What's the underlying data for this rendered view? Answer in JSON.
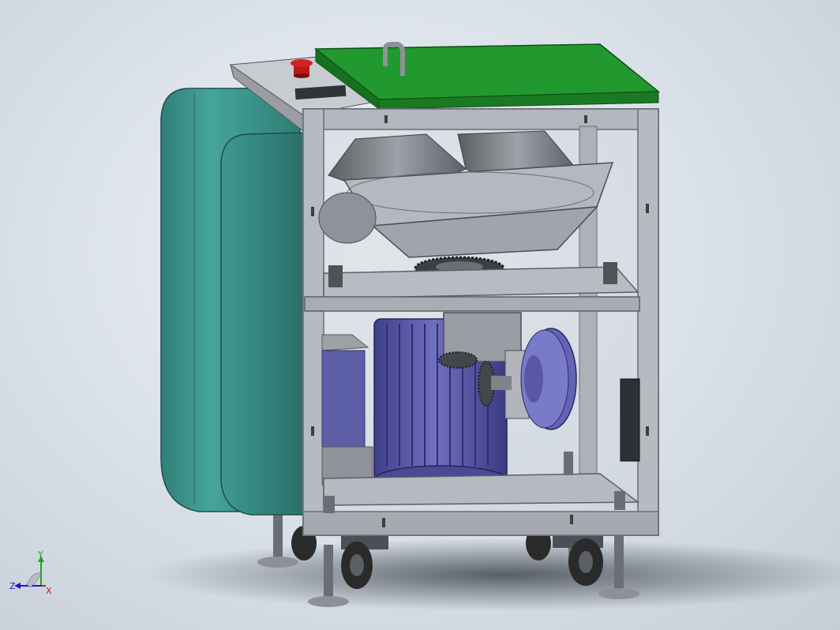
{
  "viewport": {
    "background_top": "#eef1f6",
    "background_bottom": "#c7ced8"
  },
  "model": {
    "parts": [
      "side-cover",
      "control-panel",
      "emergency-stop-button",
      "top-cover",
      "cover-handle",
      "frame",
      "hopper-tubes",
      "rotary-table",
      "gear-wheel",
      "middle-shelf",
      "drive-motor",
      "gearbox",
      "bevel-gear",
      "brake-disk",
      "side-plate",
      "base-plate",
      "caster-wheels",
      "leveling-feet"
    ],
    "colors": {
      "side_cover": "#3f9a91",
      "top_cover": "#1f8f2b",
      "frame": "#a9adb3",
      "motor": "#5a5aa8",
      "emergency_stop": "#c41818",
      "wheels": "#2a2a2a"
    }
  },
  "triad": {
    "x_label": "X",
    "y_label": "Y",
    "z_label": "Z",
    "x_color": "#d01818",
    "y_color": "#18a818",
    "z_color": "#1818d0"
  }
}
